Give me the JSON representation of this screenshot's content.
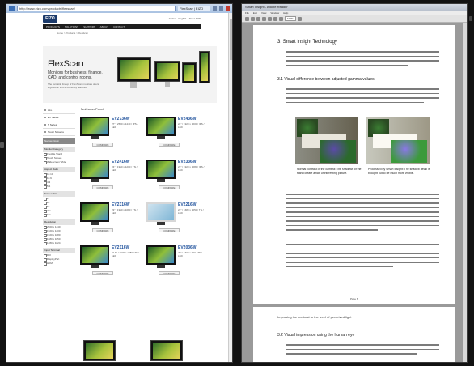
{
  "browser": {
    "address": "http://www.eizo.com/products/flexscan/",
    "tab_title": "FlexScan | EIZO"
  },
  "site": {
    "logo": "EIZO",
    "top_links": [
      "Global",
      "English",
      "About EIZO"
    ],
    "nav": [
      "PRODUCTS",
      "SOLUTIONS",
      "SUPPORT",
      "ABOUT",
      "CONTACT"
    ],
    "breadcrumb": "Home > Products > FlexScan",
    "hero_title": "FlexScan",
    "hero_subtitle": "Monitors for business, finance, CAD, and control rooms.",
    "hero_desc": "The versatile lineup of FlexScan monitors offers ergonomic and eco-friendly features."
  },
  "sidebar": {
    "items": [
      "ALL",
      "EV Series",
      "S Series",
      "Touch Screens"
    ],
    "sections": [
      {
        "title": "Narrow Down",
        "dark": true
      },
      {
        "title": "Monitor Category",
        "options": [
          "Flexible Stand",
          "Touch Screen",
          "Widescreen Wide"
        ]
      },
      {
        "title": "Aspect Ratio",
        "options": [
          "16:10",
          "16:9",
          "4:3",
          "5:4"
        ]
      },
      {
        "title": "Screen Size",
        "options": [
          "27\"",
          "24\"",
          "23\"",
          "22\"",
          "19\""
        ]
      },
      {
        "title": "Resolution",
        "options": [
          "2560 x 1440",
          "1920 x 1200",
          "1920 x 1080",
          "1680 x 1050",
          "1280 x 1024"
        ]
      },
      {
        "title": "Input Terminal",
        "options": [
          "DVI",
          "DisplayPort",
          "HDMI"
        ]
      }
    ]
  },
  "products": {
    "title": "Multiscan Panel",
    "items": [
      {
        "name": "EV2736W",
        "spec": "27\" / 2560 x 1440 / IPS / LED",
        "btn": "COMPARE"
      },
      {
        "name": "EV2436W",
        "spec": "24\" / 1920 x 1200 / IPS / LED",
        "btn": "COMPARE"
      },
      {
        "name": "EV2416W",
        "spec": "24\" / 1920 x 1200 / TN / LED",
        "btn": "COMPARE"
      },
      {
        "name": "EV2336W",
        "spec": "23\" / 1920 x 1080 / IPS / LED",
        "btn": "COMPARE"
      },
      {
        "name": "EV2316W",
        "spec": "23\" / 1920 x 1080 / TN / LED",
        "btn": "COMPARE"
      },
      {
        "name": "EV2216W",
        "spec": "22\" / 1680 x 1050 / TN / LED",
        "btn": "COMPARE"
      },
      {
        "name": "EV2116W",
        "spec": "21.5\" / 1920 x 1080 / TN / LED",
        "btn": "COMPARE"
      },
      {
        "name": "EV2036W",
        "spec": "20\" / 1600 x 900 / TN / LED",
        "btn": "COMPARE"
      }
    ]
  },
  "pdf": {
    "window_title": "Smart Insight - Adobe Reader",
    "menu": [
      "File",
      "Edit",
      "View",
      "Window",
      "Help"
    ],
    "zoom": "100%",
    "heading": "3. Smart Insight Technology",
    "subheading": "3.1 Visual difference between adjusted gamma values",
    "caption_left": "Normal contrast of the camera: The shadows of the stand create a flat, uninteresting picture.",
    "caption_right": "Processed by Smart Insight: The shadow detail is brought out to be much more visible.",
    "page_label": "Page 6",
    "page2_text": "Improving the contrast to the level of perceived light",
    "page2_heading": "3.2 Visual impression using the human eye"
  }
}
